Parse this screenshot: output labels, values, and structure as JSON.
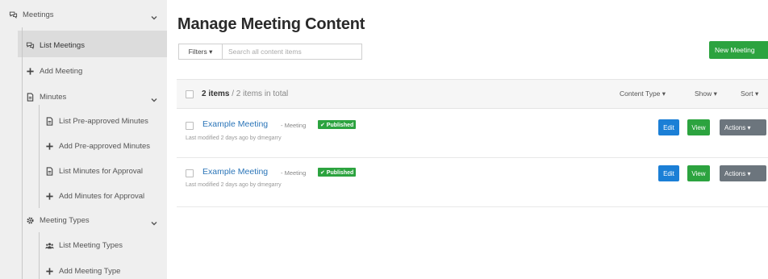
{
  "sidebar": {
    "meetings": "Meetings",
    "list_meetings": "List Meetings",
    "add_meeting": "Add Meeting",
    "minutes": "Minutes",
    "list_preapproved": "List Pre-approved Minutes",
    "add_preapproved": "Add Pre-approved Minutes",
    "list_for_approval": "List Minutes for Approval",
    "add_for_approval": "Add Minutes for Approval",
    "meeting_types": "Meeting Types",
    "list_meeting_types": "List Meeting Types",
    "add_meeting_type": "Add Meeting Type"
  },
  "main": {
    "title": "Manage Meeting Content",
    "filters_label": "Filters ▾",
    "search_placeholder": "Search all content items",
    "new_button": "New Meeting",
    "count_bold": "2 items",
    "count_rest": " / 2 items in total",
    "content_type": "Content Type ▾",
    "show": "Show ▾",
    "sort": "Sort ▾"
  },
  "items": [
    {
      "title": "Example Meeting",
      "type": "- Meeting",
      "status": "✔ Published",
      "meta": "Last modified 2 days ago by dmegarry",
      "edit": "Edit",
      "view": "View",
      "actions": "Actions ▾"
    },
    {
      "title": "Example Meeting",
      "type": "- Meeting",
      "status": "✔ Published",
      "meta": "Last modified 2 days ago by dmegarry",
      "edit": "Edit",
      "view": "View",
      "actions": "Actions ▾"
    }
  ],
  "colors": {
    "green": "#2ca33f",
    "blue": "#1b7fd6",
    "grey_button": "#6c757d",
    "link": "#2b75b8"
  }
}
